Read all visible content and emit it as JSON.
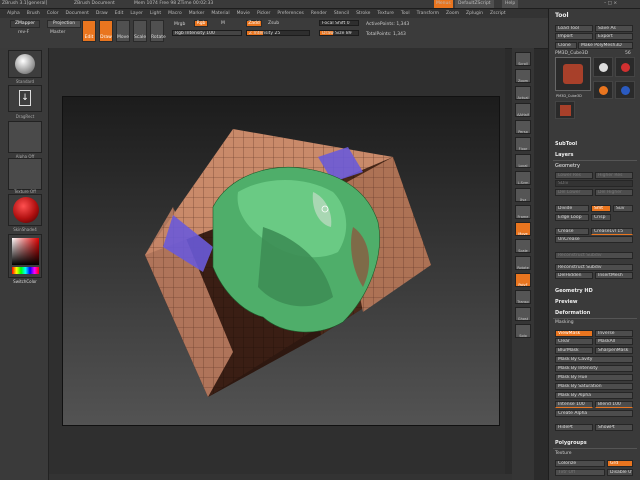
{
  "titlebar": {
    "app": "ZBrush 3.1[general]",
    "doc": "ZBrush Document",
    "mem": "Mem 1074 Free 98 ZTime 00:02:33",
    "menu_btn": "Menus",
    "script": "DefaultZScript",
    "help": "Help"
  },
  "menus": [
    "Alpha",
    "Brush",
    "Color",
    "Document",
    "Draw",
    "Edit",
    "Layer",
    "Light",
    "Macro",
    "Marker",
    "Material",
    "Movie",
    "Picker",
    "Preferences",
    "Render",
    "Stencil",
    "Stroke",
    "Texture",
    "Tool",
    "Transform",
    "Zoom",
    "Zplugin",
    "Zscript"
  ],
  "shelf": {
    "zmapper": "ZMapper",
    "zmapper_sub": "rev-F",
    "projection": "Projection",
    "master": "Master",
    "edit": "Edit",
    "draw": "Draw",
    "move": "Move",
    "scale": "Scale",
    "rotate": "Rotate",
    "mrgb": "Mrgb",
    "rgb": "Rgb",
    "m": "M",
    "zadd": "Zadd",
    "zsub": "Zsub",
    "rgb_intensity": "Rgb Intensity 100",
    "z_intensity": "Z Intensity 25",
    "focal_shift": "Focal Shift 0",
    "draw_size": "Draw Size 89",
    "active_points": "ActivePoints: 1,343",
    "total_points": "TotalPoints: 1,343"
  },
  "left": {
    "brush": "Standard",
    "stroke": "DragRect",
    "alpha": "Alpha Off",
    "texture": "Texture Off",
    "material": "SkinShade4",
    "switch_color": "SwitchColor",
    "brush_color": "#d8d8d8",
    "material_color": "#b01010"
  },
  "ricons": [
    "Scroll",
    "Zoom",
    "Actual",
    "AAHalf",
    "Persp",
    "Floor",
    "Local",
    "L.Sym",
    "Xyz",
    "Frame",
    "Move",
    "Scale",
    "Rotate",
    "PolyF",
    "Transp",
    "Ghost",
    "Solo"
  ],
  "panel": {
    "title": "Tool",
    "load_tool": "Load Tool",
    "save_as": "Save As",
    "import": "Import",
    "export": "Export",
    "clone": "Clone",
    "make_polymesh": "Make PolyMesh3D",
    "current_tool": "PM3D_Cube3D",
    "tool_count": "56",
    "thumb_labels": [
      "PM3D_Cube3D",
      "AlphaBrush",
      "Zsphere",
      "PM3D_Cub",
      "SimpleBrush",
      "EraserBrush",
      "PM3D_Cub"
    ],
    "subtool": "SubTool",
    "layers": "Layers",
    "geometry": "Geometry",
    "lower_res": "Lower Res",
    "higher_res": "Higher Res",
    "sdiv": "SDiv",
    "del_lower": "Del Lower",
    "del_higher": "Del Higher",
    "divide": "Divide",
    "smt": "Smt",
    "suv": "Suv",
    "edge_loop": "Edge Loop",
    "crisp": "Crisp",
    "crease": "Crease",
    "crease_lvl": "CreaseLvl 15",
    "uncrease": "UnCrease",
    "reconstruct": "Reconstruct Subdiv",
    "reconstruct_sub": "Reconstruct Subdiv",
    "del_hidden": "DelHidden",
    "insert_mesh": "InsertMesh",
    "geometry_hd": "Geometry HD",
    "preview": "Preview",
    "deformation": "Deformation",
    "masking": "Masking",
    "view_mask": "ViewMask",
    "inverse": "Inverse",
    "clear": "Clear",
    "mask_all": "MaskAll",
    "blur_mask": "BlurMask",
    "sharpen_mask": "SharpenMask",
    "mask_by_cavity": "Mask By Cavity",
    "mask_by_intensity": "Mask By Intensity",
    "mask_by_hue": "Mask By Hue",
    "mask_by_saturation": "Mask By Saturation",
    "mask_by_alpha": "Mask By Alpha",
    "intensity": "Intense 100",
    "blend": "Blend 100",
    "create_alpha": "Create Alpha",
    "hide_pt": "HidePt",
    "show_pt": "ShowPt",
    "polygroups": "Polygroups",
    "texture": "Texture",
    "colorize": "Colorize",
    "grd": "Grd",
    "txtr_off": "Txtr Off",
    "disable_uv": "Disable UV"
  },
  "colors": {
    "accent": "#e9751f",
    "cube_face": "#c98a6a",
    "mesh_green": "#4fae6a",
    "polygroup_blue": "#6a5ad8"
  }
}
